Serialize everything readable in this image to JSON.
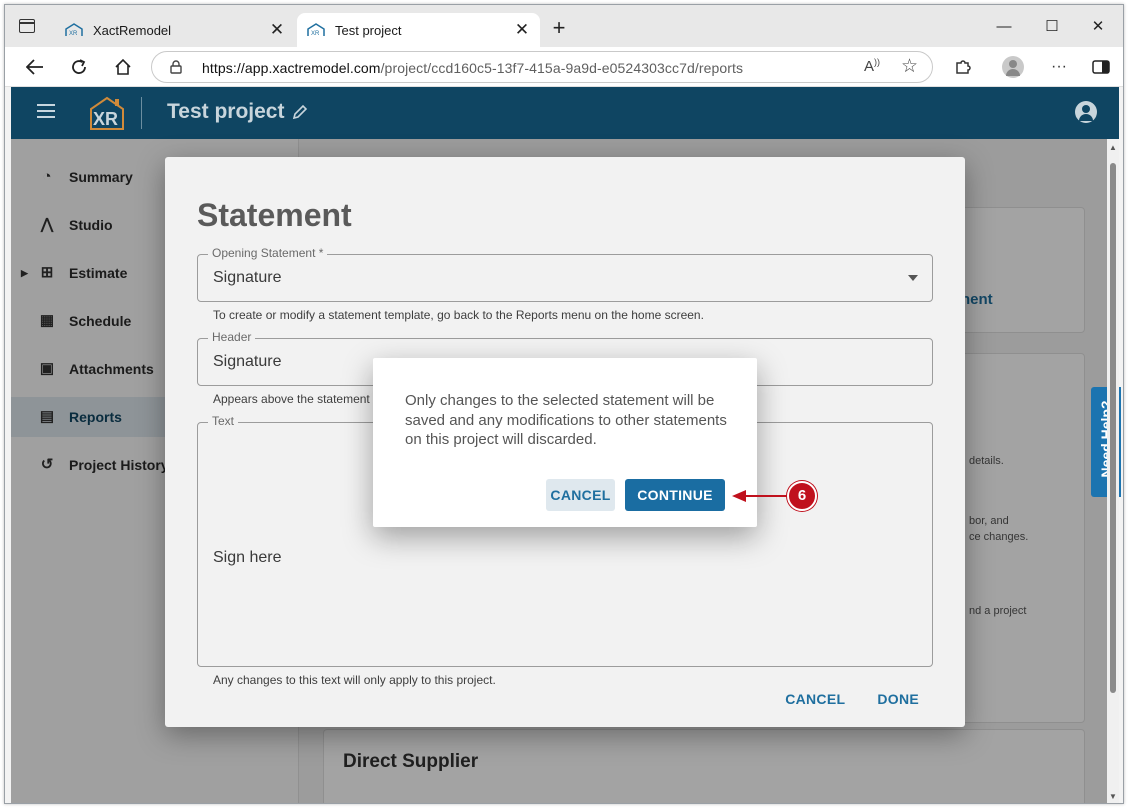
{
  "browser": {
    "tabs": [
      {
        "title": "XactRemodel",
        "active": false
      },
      {
        "title": "Test project",
        "active": true
      }
    ],
    "url_host": "https://app.xactremodel.com",
    "url_path": "/project/ccd160c5-13f7-415a-9a9d-e0524303cc7d/reports"
  },
  "app": {
    "logo_text": "XR",
    "project_title": "Test project"
  },
  "sidebar": {
    "items": [
      {
        "label": "Summary",
        "icon": "speedometer-icon"
      },
      {
        "label": "Studio",
        "icon": "compass-icon"
      },
      {
        "label": "Estimate",
        "icon": "calculator-icon"
      },
      {
        "label": "Schedule",
        "icon": "calendar-icon"
      },
      {
        "label": "Attachments",
        "icon": "image-icon"
      },
      {
        "label": "Reports",
        "icon": "document-icon",
        "active": true
      },
      {
        "label": "Project History",
        "icon": "history-icon"
      }
    ]
  },
  "background": {
    "link_fragment": "nent",
    "text_1": "details.",
    "text_2": "bor, and",
    "text_3": "ce changes.",
    "text_4": "nd a project",
    "section_title": "Direct Supplier",
    "need_help": "Need Help?"
  },
  "statement_dialog": {
    "title": "Statement",
    "opening_statement": {
      "label": "Opening Statement *",
      "value": "Signature",
      "helper": "To create or modify a statement template, go back to the Reports menu on the home screen."
    },
    "header_field": {
      "label": "Header",
      "value": "Signature",
      "helper": "Appears above the statement"
    },
    "text_field": {
      "label": "Text",
      "value": "Sign here",
      "helper": "Any changes to this text will only apply to this project."
    },
    "cancel_label": "CANCEL",
    "done_label": "DONE"
  },
  "confirm_dialog": {
    "message": "Only changes to the selected statement will be saved and any modifications to other statements on this project will discarded.",
    "cancel_label": "CANCEL",
    "continue_label": "CONTINUE"
  },
  "annotation": {
    "step_number": "6",
    "color": "#c0111d"
  },
  "colors": {
    "app_header": "#0f4562",
    "accent": "#1a6da2",
    "link": "#1f6f9f"
  }
}
